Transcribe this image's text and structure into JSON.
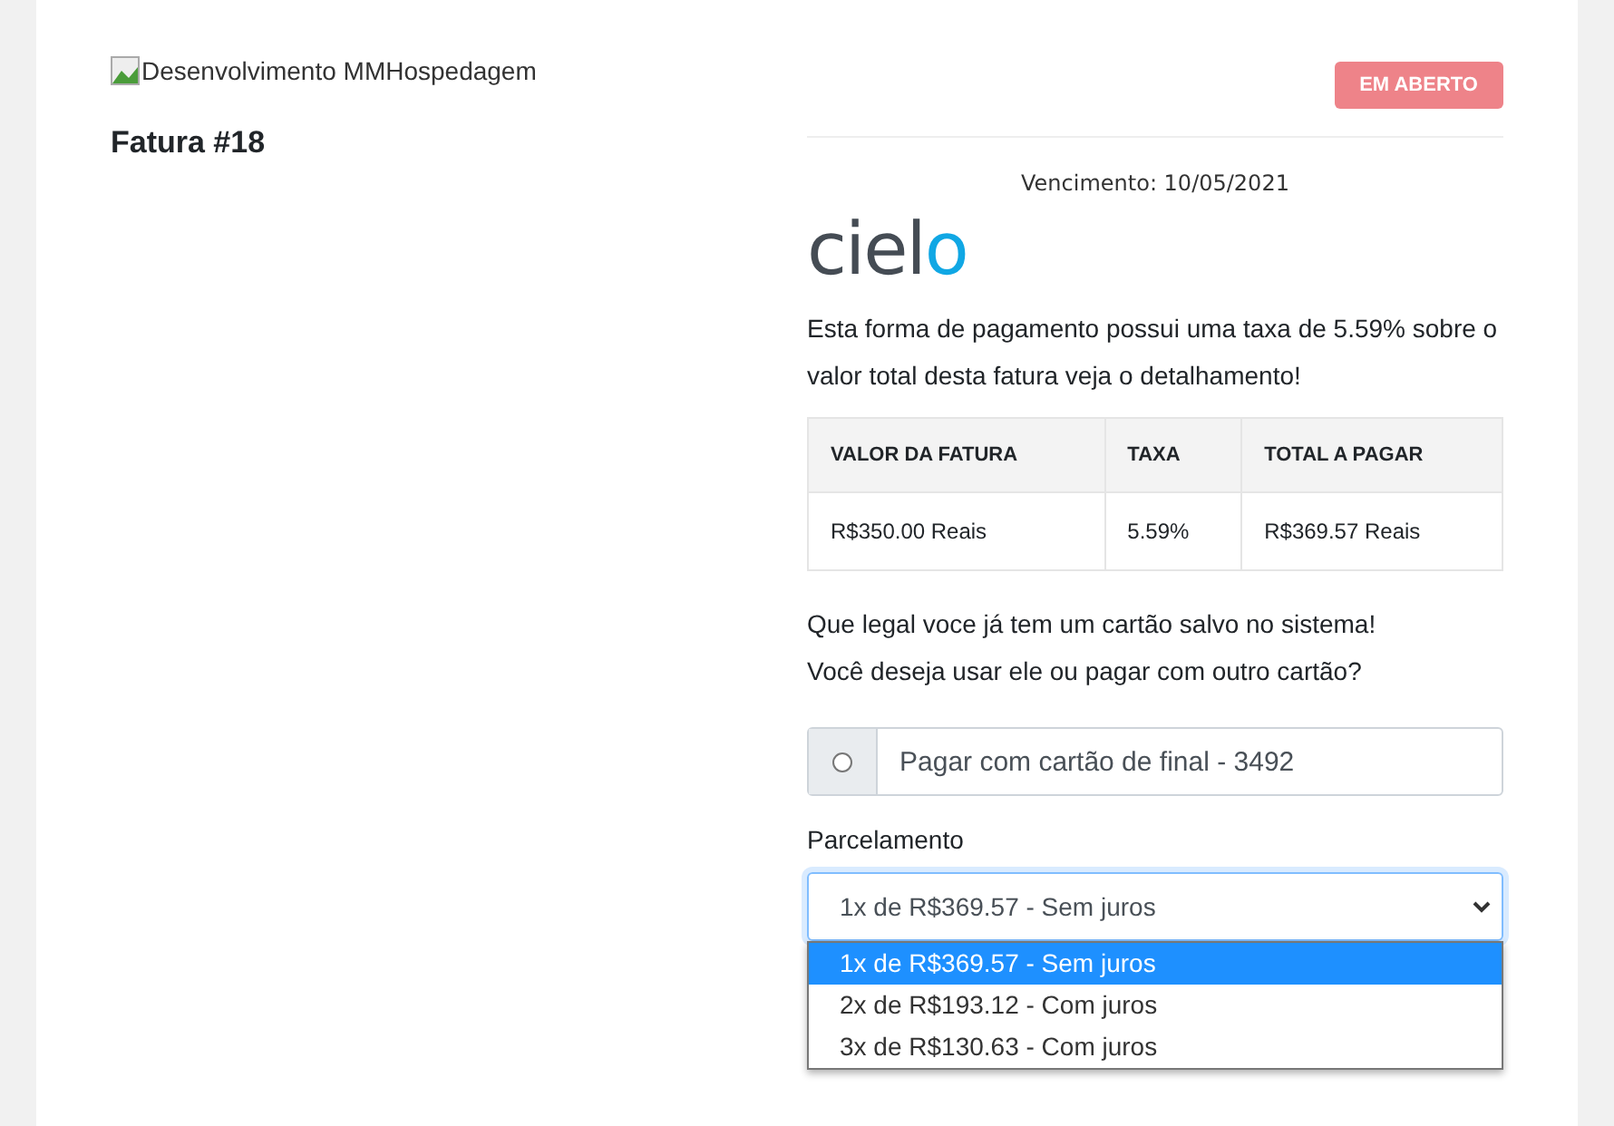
{
  "header": {
    "logo_alt": "Desenvolvimento MMHospedagem",
    "invoice_title": "Fatura #18",
    "status": "EM ABERTO"
  },
  "due": "Vencimento: 10/05/2021",
  "gateway_logo": "cielo",
  "fee_notice": "Esta forma de pagamento possui uma taxa de 5.59% sobre o valor total desta fatura veja o detalhamento!",
  "table": {
    "columns": [
      "VALOR DA FATURA",
      "TAXA",
      "TOTAL A PAGAR"
    ],
    "rows": [
      [
        "R$350.00 Reais",
        "5.59%",
        "R$369.57 Reais"
      ]
    ]
  },
  "saved_card_notice": [
    "Que legal voce já tem um cartão salvo no sistema!",
    "Você deseja usar ele ou pagar com outro cartão?"
  ],
  "saved_card": {
    "label": "Pagar com cartão de final - 3492",
    "selected": false
  },
  "installments": {
    "label": "Parcelamento",
    "value": "1x de R$369.57 - Sem juros",
    "expanded": true,
    "options": [
      {
        "label": "1x de R$369.57 - Sem juros",
        "selected": true
      },
      {
        "label": "2x de R$193.12 - Com juros",
        "selected": false
      },
      {
        "label": "3x de R$130.63 - Com juros",
        "selected": false
      }
    ]
  }
}
